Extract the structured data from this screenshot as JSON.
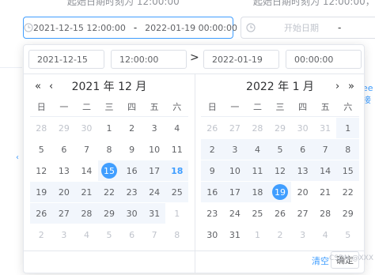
{
  "background": {
    "left_caption": "起始日期时刻为 12:00:00",
    "right_caption": "起始日期时刻为 12:00:00，结束日",
    "right_fragment": "ee 接"
  },
  "range_input": {
    "start_value": "2021-12-15 12:00:00",
    "separator": "-",
    "end_value": "2022-01-19 00:00:00"
  },
  "range_input_2": {
    "placeholder": "开始日期",
    "separator": "-"
  },
  "panel": {
    "start_date": "2021-12-15",
    "start_time": "12:00:00",
    "arrow": ">",
    "end_date": "2022-01-19",
    "end_time": "00:00:00",
    "weekdays": [
      "日",
      "一",
      "二",
      "三",
      "四",
      "五",
      "六"
    ],
    "left": {
      "title": "2021 年 12 月",
      "nav_prev_year": "«",
      "nav_prev_month": "‹",
      "rows": [
        [
          "28",
          "29",
          "30",
          "1",
          "2",
          "3",
          "4"
        ],
        [
          "5",
          "6",
          "7",
          "8",
          "9",
          "10",
          "11"
        ],
        [
          "12",
          "13",
          "14",
          "15",
          "16",
          "17",
          "18"
        ],
        [
          "19",
          "20",
          "21",
          "22",
          "23",
          "24",
          "25"
        ],
        [
          "26",
          "27",
          "28",
          "29",
          "30",
          "31",
          "1"
        ],
        [
          "2",
          "3",
          "4",
          "5",
          "6",
          "7",
          "8"
        ]
      ]
    },
    "right": {
      "title": "2022 年 1 月",
      "nav_next_month": "›",
      "nav_next_year": "»",
      "rows": [
        [
          "26",
          "27",
          "28",
          "29",
          "30",
          "31",
          "1"
        ],
        [
          "2",
          "3",
          "4",
          "5",
          "6",
          "7",
          "8"
        ],
        [
          "9",
          "10",
          "11",
          "12",
          "13",
          "14",
          "15"
        ],
        [
          "16",
          "17",
          "18",
          "19",
          "20",
          "21",
          "22"
        ],
        [
          "23",
          "24",
          "25",
          "26",
          "27",
          "28",
          "29"
        ],
        [
          "30",
          "31",
          "1",
          "2",
          "3",
          "4",
          "5"
        ]
      ]
    },
    "clear_label": "清空",
    "ok_label": "确定",
    "watermark": "CSDN @XXX"
  },
  "colors": {
    "accent": "#409eff",
    "range_bg": "#f2f6fc"
  }
}
